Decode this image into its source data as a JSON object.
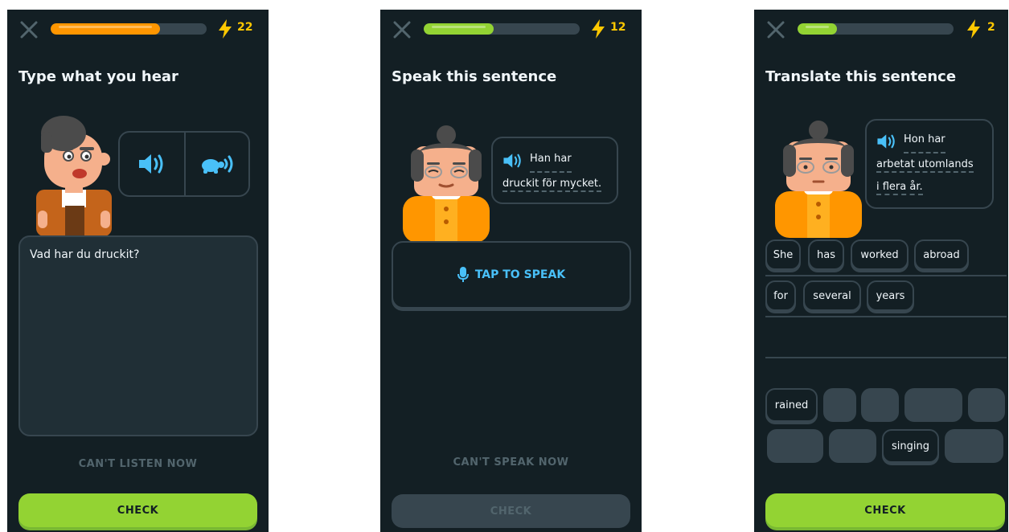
{
  "colors": {
    "background": "#131f24",
    "border": "#37464f",
    "orange": "#ff9600",
    "green": "#93d333",
    "blue": "#49c0f8",
    "bolt": "#ffc800",
    "muted": "#52656d"
  },
  "screens": [
    {
      "progress": 0.7,
      "streak_count": "22",
      "title": "Type what you hear",
      "icons": [
        "close-icon",
        "lightning-icon",
        "speaker-icon",
        "turtle-icon"
      ],
      "answer_text": "Vad har du druckit?",
      "cant_label": "CAN'T LISTEN NOW",
      "check_label": "CHECK",
      "check_enabled": true
    },
    {
      "progress": 0.45,
      "streak_count": "12",
      "title": "Speak this sentence",
      "icons": [
        "close-icon",
        "lightning-icon",
        "speaker-icon",
        "microphone-icon"
      ],
      "prompt_lines": [
        "Han har",
        "druckit för mycket."
      ],
      "tap_label": "TAP TO SPEAK",
      "cant_label": "CAN'T SPEAK NOW",
      "check_label": "CHECK",
      "check_enabled": false
    },
    {
      "progress": 0.25,
      "streak_count": "2",
      "title": "Translate this sentence",
      "icons": [
        "close-icon",
        "lightning-icon",
        "speaker-icon"
      ],
      "prompt_lines": [
        "Hon har",
        "arbetat utomlands",
        "i flera år."
      ],
      "answer_words": [
        "She",
        "has",
        "worked",
        "abroad",
        "for",
        "several",
        "years"
      ],
      "bank_words": [
        "rained",
        "singing"
      ],
      "check_label": "CHECK",
      "check_enabled": true
    }
  ]
}
